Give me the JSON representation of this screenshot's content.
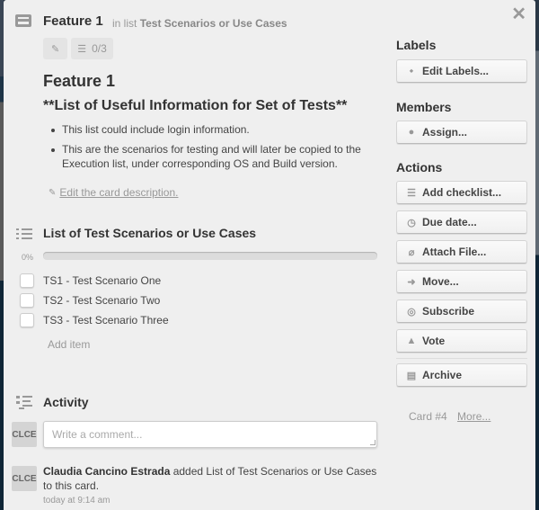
{
  "card": {
    "title": "Feature 1",
    "in_list_prefix": "in list",
    "list_name": "Test Scenarios or Use Cases",
    "badges": {
      "checklist_count": "0/3"
    }
  },
  "description": {
    "title": "Feature 1",
    "heading": "**List of Useful Information for Set of Tests**",
    "bullets": [
      "This list could include login information.",
      "This are the scenarios for testing and will later be copied to the Execution list, under corresponding OS and Build version."
    ],
    "edit_link": "Edit the card description."
  },
  "checklist": {
    "title": "List of Test Scenarios or Use Cases",
    "progress_label": "0%",
    "progress_value": 0,
    "items": [
      {
        "label": "TS1 - Test Scenario One",
        "checked": false
      },
      {
        "label": "TS2 - Test Scenario Two",
        "checked": false
      },
      {
        "label": "TS3 - Test Scenario Three",
        "checked": false
      }
    ],
    "add_item": "Add item"
  },
  "activity": {
    "title": "Activity",
    "avatar_initials": "CLCE",
    "comment_placeholder": "Write a comment...",
    "entries": [
      {
        "user": "Claudia Cancino Estrada",
        "action": " added List of Test Scenarios or Use Cases to this card.",
        "time": "today at 9:14 am",
        "avatar": "CLCE"
      }
    ]
  },
  "sidebar": {
    "labels_heading": "Labels",
    "edit_labels": "Edit Labels...",
    "members_heading": "Members",
    "assign": "Assign...",
    "actions_heading": "Actions",
    "actions": [
      {
        "label": "Add checklist...",
        "icon": "checklist-icon"
      },
      {
        "label": "Due date...",
        "icon": "clock-icon"
      },
      {
        "label": "Attach File...",
        "icon": "paperclip-icon"
      },
      {
        "label": "Move...",
        "icon": "arrow-right-icon"
      },
      {
        "label": "Subscribe",
        "icon": "eye-icon"
      },
      {
        "label": "Vote",
        "icon": "thumbs-up-icon"
      }
    ],
    "archive": "Archive",
    "card_number": "Card #4",
    "more_link": "More..."
  },
  "colors": {
    "dialog_bg": "#efefef",
    "backdrop": "#1c2a38",
    "progress_fill": "#5ba4cf"
  }
}
